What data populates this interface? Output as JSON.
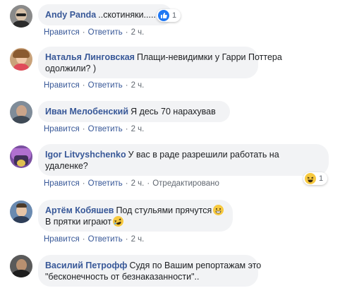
{
  "comments": [
    {
      "author": "Andy Panda",
      "text": "..скотиняки.....",
      "actions": {
        "like": "Нравится",
        "reply": "Ответить",
        "time": "2 ч."
      },
      "reaction": {
        "type": "like",
        "count": "1"
      },
      "avatar_color": "#6b6b6b"
    },
    {
      "author": "Наталья Линговская",
      "text_line1": "Плащи-невидимки у Гарри Поттера",
      "text_line2": "одолжили? )",
      "actions": {
        "like": "Нравится",
        "reply": "Ответить",
        "time": "2 ч."
      },
      "avatar_color": "#c9a27a"
    },
    {
      "author": "Иван Мелобенский",
      "text": "Я десь 70 нарахував",
      "actions": {
        "like": "Нравится",
        "reply": "Ответить",
        "time": "2 ч."
      },
      "avatar_color": "#5d6a78"
    },
    {
      "author": "Igor Litvyshchenko",
      "text_line1": "У вас в раде разрешили работать на",
      "text_line2": "удаленке?",
      "actions": {
        "like": "Нравится",
        "reply": "Ответить",
        "time": "2 ч.",
        "edited": "Отредактировано"
      },
      "reaction": {
        "type": "haha",
        "count": "1"
      },
      "avatar_color": "#7a4fa0"
    },
    {
      "author": "Артём Кобяшев",
      "text_line1": "Под стульями прячутся",
      "text_line2": "В прятки играют",
      "actions": {
        "like": "Нравится",
        "reply": "Ответить",
        "time": "2 ч."
      },
      "avatar_color": "#4a6a90"
    },
    {
      "author": "Василий Петрофф",
      "text_line1": "Судя по Вашим репортажам это",
      "text_line2": "\"бесконечность от безнаказанности\"..",
      "avatar_color": "#3d3d3d"
    }
  ],
  "colors": {
    "link": "#385898",
    "bubble": "#f2f3f5",
    "meta": "#606770",
    "like": "#2078f4",
    "haha": "#f7c93f"
  }
}
